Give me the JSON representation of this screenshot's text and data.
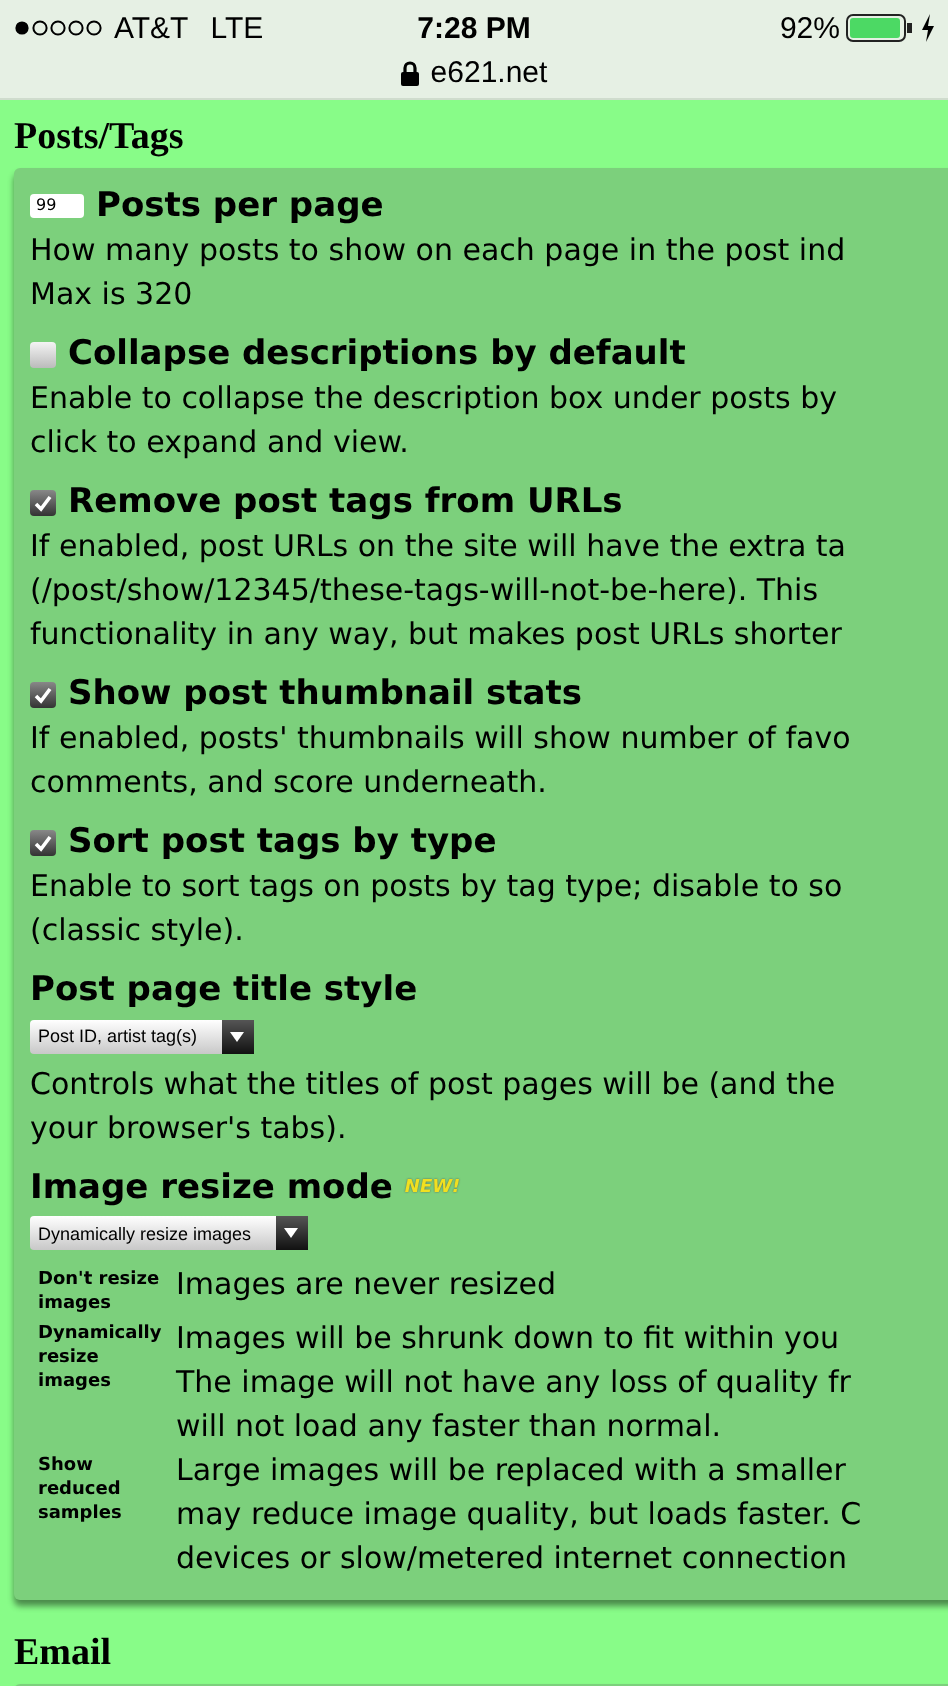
{
  "status_bar": {
    "carrier": "AT&T",
    "network": "LTE",
    "time": "7:28 PM",
    "battery": "92%",
    "charging": true,
    "secure": true,
    "url": "e621.net"
  },
  "sections": [
    {
      "title": "Posts/Tags",
      "settings": [
        {
          "kind": "number",
          "value": "99",
          "label": "Posts per page",
          "lines": [
            "How many posts to show on each page in the post ind",
            "Max is 320"
          ]
        },
        {
          "kind": "checkbox",
          "checked": false,
          "label": "Collapse descriptions by default",
          "lines": [
            "Enable to collapse the description box under posts by",
            "click to expand and view."
          ]
        },
        {
          "kind": "checkbox",
          "checked": true,
          "label": "Remove post tags from URLs",
          "lines": [
            "If enabled, post URLs on the site will have the extra ta",
            "(/post/show/12345/these-tags-will-not-be-here). This",
            "functionality in any way, but makes post URLs shorter"
          ]
        },
        {
          "kind": "checkbox",
          "checked": true,
          "label": "Show post thumbnail stats",
          "lines": [
            "If enabled, posts' thumbnails will show number of favo",
            "comments, and score underneath."
          ]
        },
        {
          "kind": "checkbox",
          "checked": true,
          "label": "Sort post tags by type",
          "lines": [
            "Enable to sort tags on posts by tag type; disable to so",
            "(classic style)."
          ]
        },
        {
          "kind": "select",
          "label": "Post page title style",
          "value": "Post ID, artist tag(s)",
          "lines": [
            "Controls what the titles of post pages will be (and the",
            "your browser's tabs)."
          ]
        },
        {
          "kind": "select",
          "label": "Image resize mode",
          "badge": "NEW!",
          "value": "Dynamically resize images",
          "options": [
            {
              "name": "Don't resize images",
              "lines": [
                "Images are never resized"
              ]
            },
            {
              "name": "Dynamically resize images",
              "lines": [
                "Images will be shrunk down to fit within you",
                "The image will not have any loss of quality fr",
                "will not load any faster than normal."
              ]
            },
            {
              "name": "Show reduced samples",
              "lines": [
                "Large images will be replaced with a smaller",
                "may reduce image quality, but loads faster. C",
                "devices or slow/metered internet connection"
              ]
            }
          ]
        }
      ]
    },
    {
      "title": "Email"
    }
  ]
}
